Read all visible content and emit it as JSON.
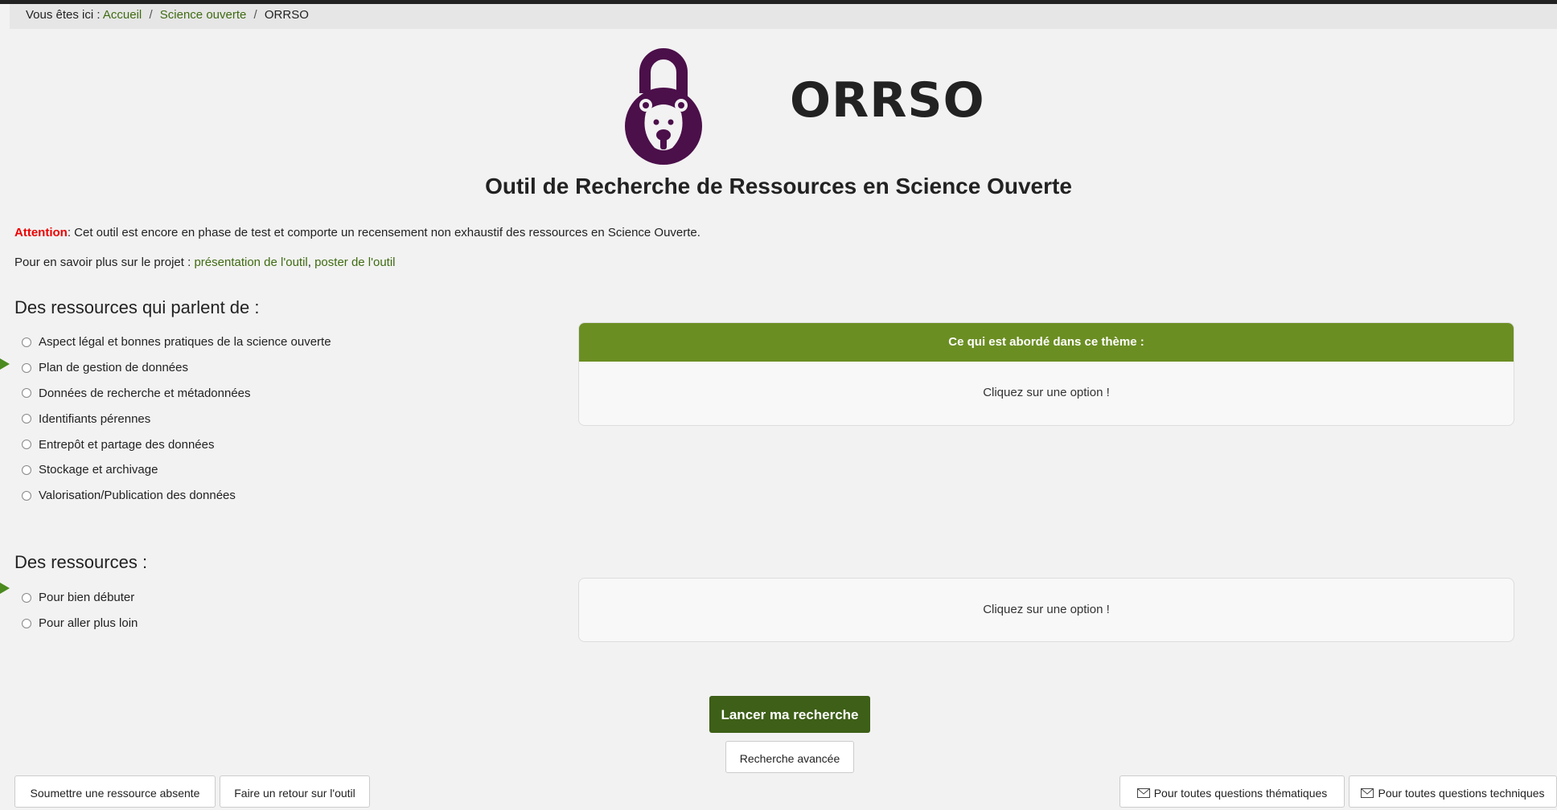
{
  "breadcrumb": {
    "prefix": "Vous êtes ici :",
    "items": [
      "Accueil",
      "Science ouverte",
      "ORRSO"
    ]
  },
  "app": {
    "title": "ORRSO",
    "subtitle": "Outil de Recherche de Ressources en Science Ouverte",
    "logo_icon": "open-padlock-bear-icon",
    "logo_color": "#4b0f4a"
  },
  "notice": {
    "label": "Attention",
    "text": ": Cet outil est encore en phase de test et comporte un recensement non exhaustif des ressources en Science Ouverte."
  },
  "info": {
    "prefix": "Pour en savoir plus sur le projet : ",
    "link1": "présentation de l'outil",
    "separator": ", ",
    "link2": "poster de l'outil"
  },
  "themes": {
    "title": "Des ressources qui parlent de :",
    "options": [
      "Aspect légal et bonnes pratiques de la science ouverte",
      "Plan de gestion de données",
      "Données de recherche et métadonnées",
      "Identifiants pérennes",
      "Entrepôt et partage des données",
      "Stockage et archivage",
      "Valorisation/Publication des données"
    ],
    "panel_header": "Ce qui est abordé dans ce thème :",
    "panel_text": "Cliquez sur une option !"
  },
  "levels": {
    "title": "Des ressources :",
    "options": [
      "Pour bien débuter",
      "Pour aller plus loin"
    ],
    "panel_text": "Cliquez sur une option !"
  },
  "actions": {
    "search": "Lancer ma recherche",
    "advanced": "Recherche avancée",
    "submit_resource": "Soumettre une ressource absente",
    "feedback": "Faire un retour sur l'outil",
    "contact_thematic": "Pour toutes questions thématiques",
    "contact_technical": "Pour toutes questions techniques"
  },
  "colors": {
    "accent_green": "#6b8e23",
    "button_green": "#3d5f17",
    "link_green": "#3f6b12",
    "alert_red": "#e00000"
  }
}
